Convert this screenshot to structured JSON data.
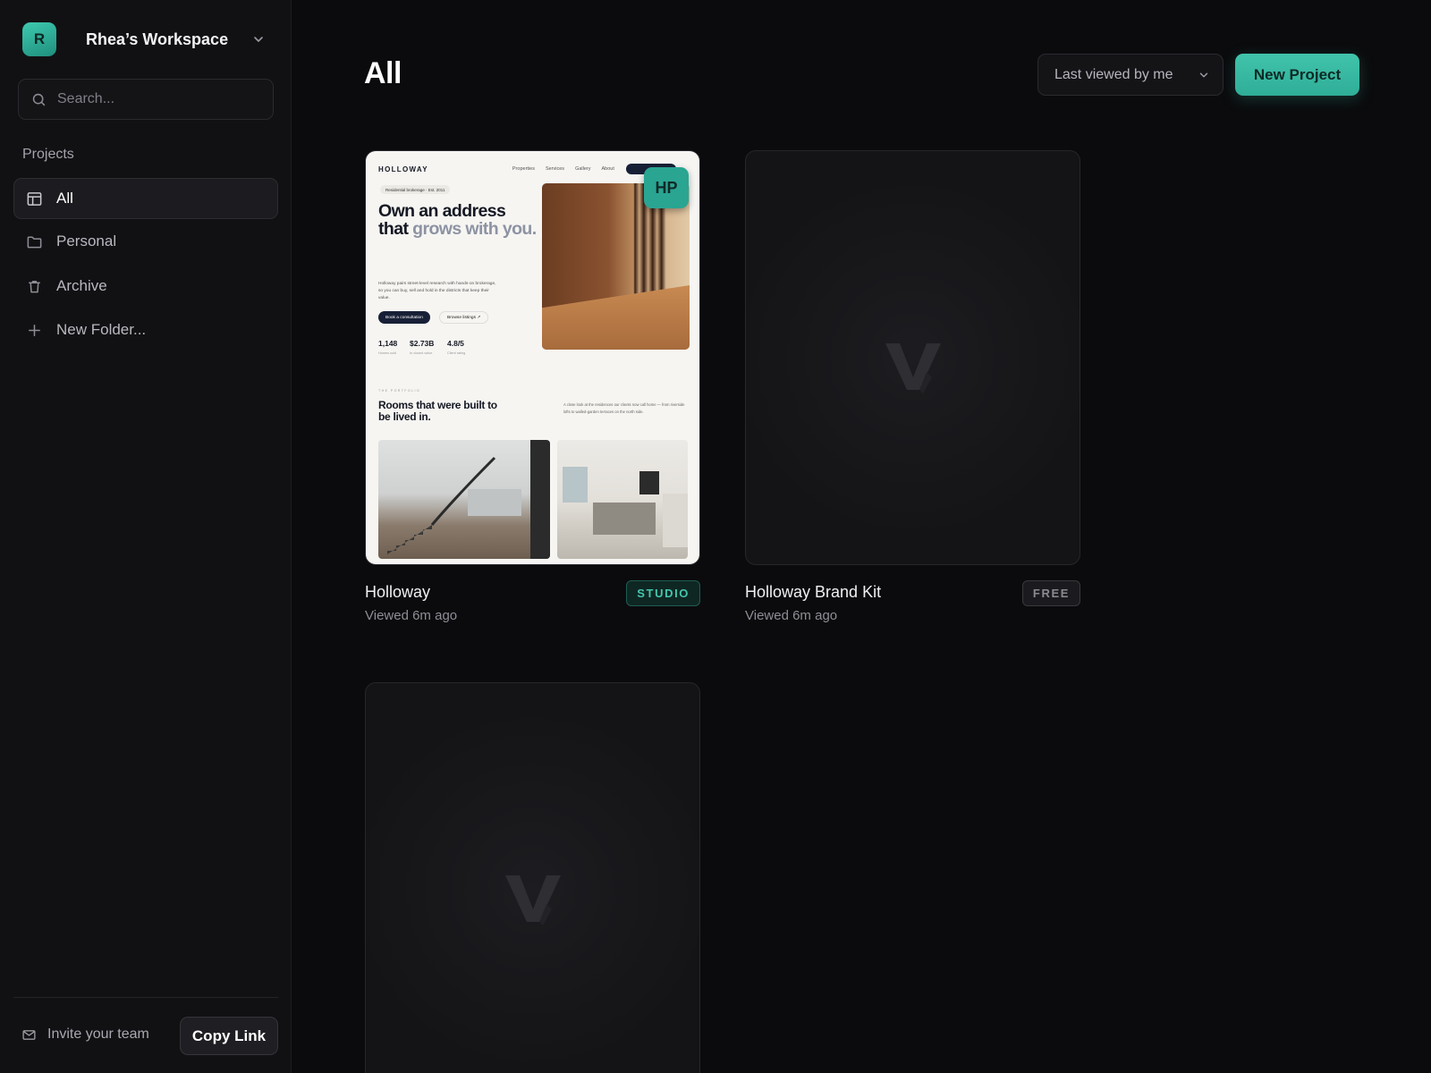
{
  "workspace": {
    "initial": "R",
    "name": "Rhea’s Workspace"
  },
  "search": {
    "placeholder": "Search..."
  },
  "sidebar": {
    "section_label": "Projects",
    "items": [
      {
        "label": "All",
        "icon": "layout-icon",
        "active": true
      },
      {
        "label": "Personal",
        "icon": "folder-icon",
        "active": false
      },
      {
        "label": "Archive",
        "icon": "trash-icon",
        "active": false
      },
      {
        "label": "New Folder...",
        "icon": "plus-icon",
        "active": false
      }
    ],
    "invite_label": "Invite your team",
    "copy_link_label": "Copy Link"
  },
  "main": {
    "title": "All",
    "sort": {
      "selected": "Last viewed by me"
    },
    "new_project_label": "New Project"
  },
  "projects": [
    {
      "name": "Holloway",
      "meta": "Viewed 6m ago",
      "badge": "STUDIO",
      "owner_initials": "HP",
      "preview": {
        "brand": "HOLLOWAY",
        "nav_links": [
          "Properties",
          "Services",
          "Gallery",
          "About"
        ],
        "pill": "Residential brokerage · Est. 2011",
        "headline_dark": "Own an address that",
        "headline_muted": "grows with you.",
        "body": "Holloway pairs street-level research with hands-on brokerage, so you can buy, sell and hold in the districts that keep their value.",
        "cta_primary": "Book a consultation",
        "cta_secondary": "Browse listings ↗",
        "stats": [
          {
            "value": "1,148",
            "label": "Homes sold"
          },
          {
            "value": "$2.73B",
            "label": "In closed value"
          },
          {
            "value": "4.8/5",
            "label": "Client rating"
          }
        ],
        "kicker": "THE PORTFOLIO",
        "section_title": "Rooms that were built to be lived in.",
        "section_body": "A close look at the residences our clients now call home — from riverside lofts to walled-garden terraces on the north side."
      }
    },
    {
      "name": "Holloway Brand Kit",
      "meta": "Viewed 6m ago",
      "badge": "FREE"
    },
    {
      "name": "",
      "meta": "",
      "badge": ""
    }
  ],
  "colors": {
    "accent": "#3dbba3",
    "background": "#0b0b0d",
    "sidebar": "#111113"
  }
}
